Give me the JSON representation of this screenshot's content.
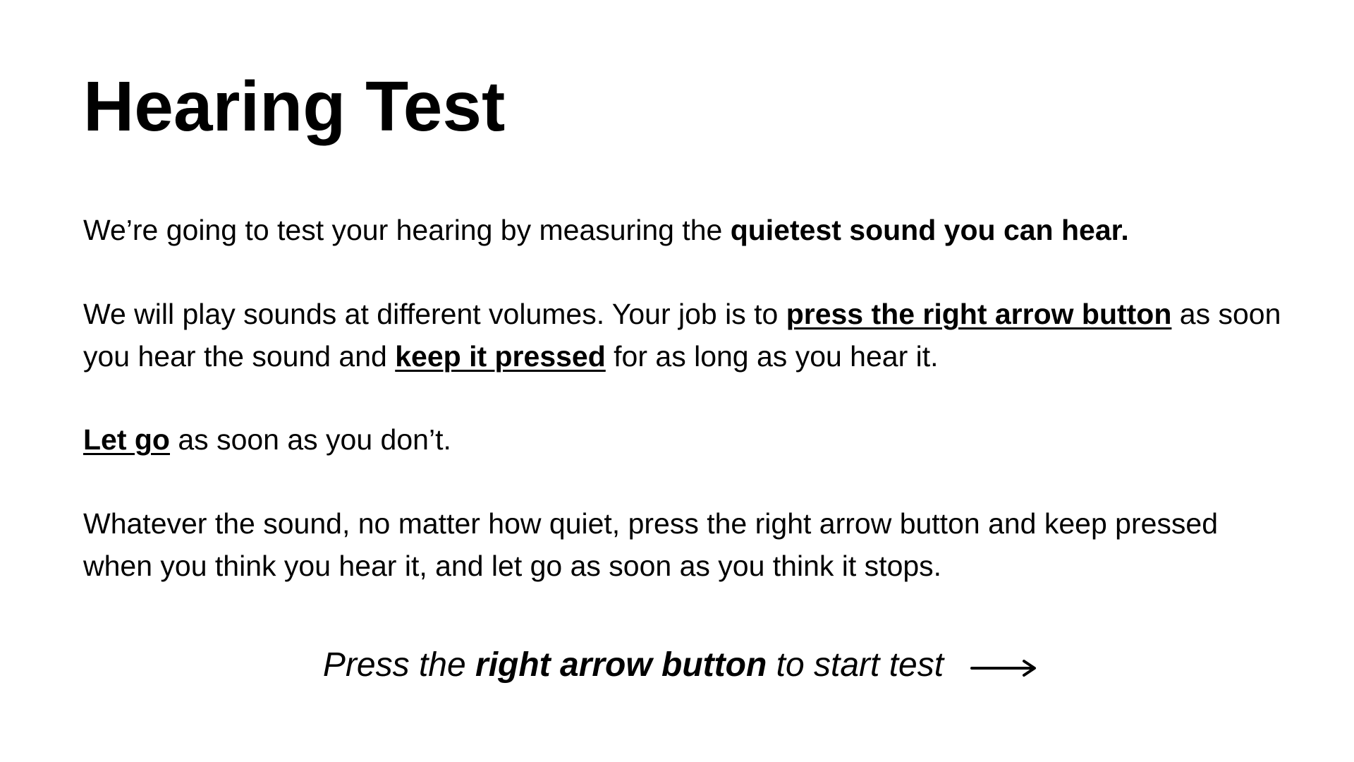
{
  "title": "Hearing Test",
  "paragraph1": {
    "text": "We’re going to test your hearing by measuring the ",
    "bold": "quietest sound you can hear."
  },
  "paragraph2": {
    "text_a": "We will play sounds at different volumes. Your job is to ",
    "underline_a": "press the right arrow button",
    "text_b": " as soon you hear the sound and ",
    "underline_b": "keep it pressed",
    "text_c": " for as long as you hear it."
  },
  "paragraph3": {
    "underline": "Let go",
    "text": " as soon as you don’t."
  },
  "paragraph4": {
    "text": "Whatever the sound, no matter how quiet, press the right arrow button and keep pressed when you think you hear it, and let go as soon as you think it stops."
  },
  "cta": {
    "prefix": "Press the ",
    "bold": "right arrow button",
    "suffix": " to start test",
    "icon": "right-arrow-icon"
  }
}
